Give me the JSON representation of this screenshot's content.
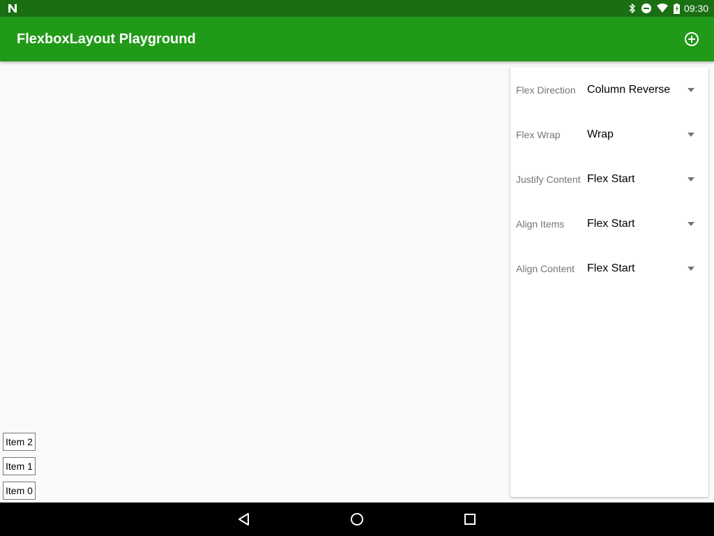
{
  "status_bar": {
    "time": "09:30"
  },
  "toolbar": {
    "title": "FlexboxLayout Playground"
  },
  "items": [
    "Item 2",
    "Item 1",
    "Item 0"
  ],
  "settings": [
    {
      "label": "Flex Direction",
      "value": "Column Reverse"
    },
    {
      "label": "Flex Wrap",
      "value": "Wrap"
    },
    {
      "label": "Justify Content",
      "value": "Flex Start"
    },
    {
      "label": "Align Items",
      "value": "Flex Start"
    },
    {
      "label": "Align Content",
      "value": "Flex Start"
    }
  ],
  "colors": {
    "toolbar": "#229a19",
    "status_bar": "#1a6f12"
  }
}
